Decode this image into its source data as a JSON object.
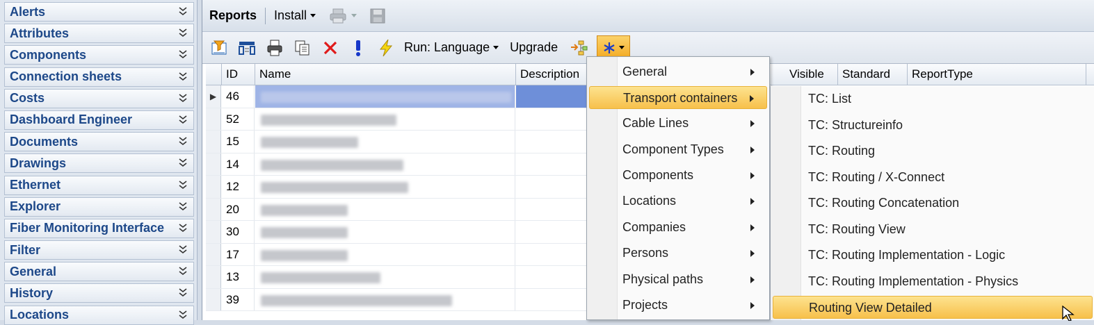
{
  "sidebar": {
    "items": [
      {
        "label": "Alerts"
      },
      {
        "label": "Attributes"
      },
      {
        "label": "Components"
      },
      {
        "label": "Connection sheets"
      },
      {
        "label": "Costs"
      },
      {
        "label": "Dashboard Engineer"
      },
      {
        "label": "Documents"
      },
      {
        "label": "Drawings"
      },
      {
        "label": "Ethernet"
      },
      {
        "label": "Explorer"
      },
      {
        "label": "Fiber Monitoring Interface"
      },
      {
        "label": "Filter"
      },
      {
        "label": "General"
      },
      {
        "label": "History"
      },
      {
        "label": "Locations"
      }
    ]
  },
  "header": {
    "title": "Reports",
    "install_label": "Install"
  },
  "toolbar": {
    "run_label": "Run: Language",
    "upgrade_label": "Upgrade"
  },
  "grid": {
    "columns": [
      "ID",
      "Name",
      "Description",
      "Visible",
      "Standard",
      "ReportType"
    ],
    "rows": [
      {
        "id": "46",
        "selected": true
      },
      {
        "id": "52"
      },
      {
        "id": "15"
      },
      {
        "id": "14"
      },
      {
        "id": "12"
      },
      {
        "id": "20"
      },
      {
        "id": "30"
      },
      {
        "id": "17"
      },
      {
        "id": "13"
      },
      {
        "id": "39"
      }
    ]
  },
  "menu": {
    "items": [
      {
        "label": "General"
      },
      {
        "label": "Transport containers",
        "highlighted": true
      },
      {
        "label": "Cable Lines"
      },
      {
        "label": "Component Types"
      },
      {
        "label": "Components"
      },
      {
        "label": "Locations"
      },
      {
        "label": "Companies"
      },
      {
        "label": "Persons"
      },
      {
        "label": "Physical paths"
      },
      {
        "label": "Projects"
      }
    ]
  },
  "submenu": {
    "items": [
      {
        "label": "TC: List"
      },
      {
        "label": "TC: Structureinfo"
      },
      {
        "label": "TC: Routing"
      },
      {
        "label": "TC: Routing / X-Connect"
      },
      {
        "label": "TC: Routing Concatenation"
      },
      {
        "label": "TC: Routing View"
      },
      {
        "label": "TC: Routing Implementation - Logic"
      },
      {
        "label": "TC: Routing Implementation - Physics"
      },
      {
        "label": "Routing View Detailed",
        "highlighted": true
      }
    ]
  },
  "colors": {
    "sidebar_text": "#1d4889",
    "highlight": "#f7c04b",
    "selection": "#6e8fd9"
  }
}
